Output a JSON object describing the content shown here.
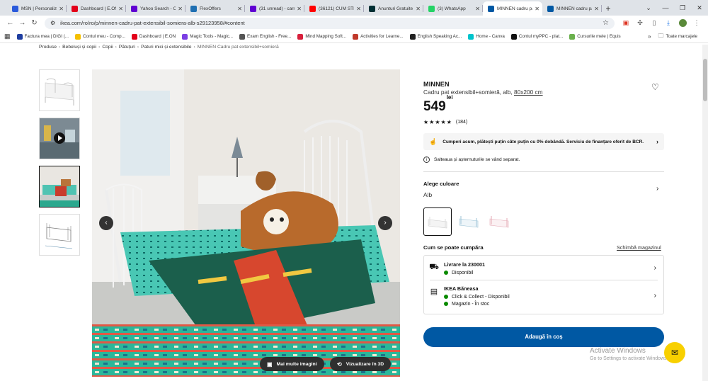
{
  "tabs": [
    {
      "title": "MSN | Personalize",
      "color": "#2b5adb",
      "active": false
    },
    {
      "title": "Dashboard | E.ON",
      "color": "#e3001a",
      "active": false
    },
    {
      "title": "Yahoo Search - C",
      "color": "#6001d2",
      "active": false
    },
    {
      "title": "FlexOffers",
      "color": "#1f6fb2",
      "active": false
    },
    {
      "title": "(31 unread) - carr",
      "color": "#6001d2",
      "active": false
    },
    {
      "title": "(36121) CUM STIM",
      "color": "#ff0000",
      "active": false
    },
    {
      "title": "Anunturi Gratuite",
      "color": "#002f34",
      "active": false
    },
    {
      "title": "(3) WhatsApp",
      "color": "#25d366",
      "active": false
    },
    {
      "title": "MINNEN cadru pa",
      "color": "#0058a3",
      "active": true
    },
    {
      "title": "MINNEN cadru pa",
      "color": "#0058a3",
      "active": false
    }
  ],
  "url": "ikea.com/ro/ro/p/minnen-cadru-pat-extensibil-somiera-alb-s29123958/#content",
  "bookmarks": [
    {
      "label": "Factura mea | DIGI (...",
      "color": "#1f3ea0"
    },
    {
      "label": "Contul meu - Comp...",
      "color": "#f5c000"
    },
    {
      "label": "Dashboard | E.ON",
      "color": "#e3001a"
    },
    {
      "label": "Magic Tools - Magic...",
      "color": "#7b3fe4"
    },
    {
      "label": "Exam English - Free...",
      "color": "#555555"
    },
    {
      "label": "Mind Mapping Soft...",
      "color": "#d8203c"
    },
    {
      "label": "Activities for Learne...",
      "color": "#c0392b"
    },
    {
      "label": "English Speaking Ac...",
      "color": "#222222"
    },
    {
      "label": "Home - Canva",
      "color": "#00c4cc"
    },
    {
      "label": "Contul myPPC - plat...",
      "color": "#111111"
    },
    {
      "label": "Cursurile mele | Equis",
      "color": "#6ab04c"
    }
  ],
  "bookmarks_more": "Toate marcajele",
  "breadcrumb": [
    "Produse",
    "Bebeluși și copii",
    "Copii",
    "Pătuțuri",
    "Paturi mici și extensibile",
    "MINNEN Cadru pat extensibil+somieră"
  ],
  "product": {
    "brand": "MINNEN",
    "desc_main": "Cadru pat extensibil+somieră, alb, ",
    "desc_size": "80x200 cm",
    "price": "549",
    "currency": "lei",
    "rating_count": "(184)",
    "financing": "Cumperi acum, plătești puțin câte puțin cu 0% dobândă. Serviciu de finanțare oferit de BCR.",
    "note": "Salteaua și așternuturile se vând separat.",
    "color_heading": "Alege culoare",
    "color_value": "Alb",
    "buy_heading": "Cum se poate cumpăra",
    "store_link": "Schimbă magazinul",
    "delivery_title": "Livrare la 230001",
    "delivery_status": "Disponibil",
    "store_title": "IKEA Băneasa",
    "store_line1": "Click & Collect - Disponibil",
    "store_line2": "Magazin - În stoc",
    "add_button": "Adaugă în coș"
  },
  "gallery": {
    "more_images": "Mai multe imagini",
    "view_3d": "Vizualizare în 3D"
  },
  "watermark": {
    "line1": "Activate Windows",
    "line2": "Go to Settings to activate Windows."
  },
  "accent": "#0058a3",
  "ikea_yellow": "#f8d000"
}
